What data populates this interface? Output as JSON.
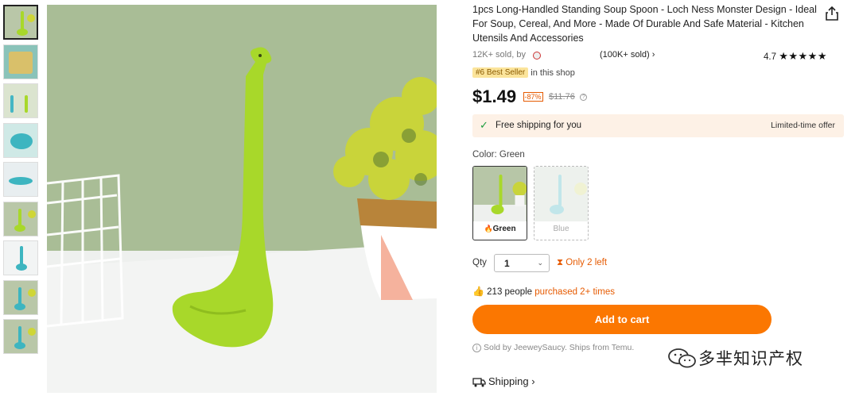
{
  "product": {
    "title": "1pcs Long-Handled Standing Soup Spoon - Loch Ness Monster Design - Ideal For Soup, Cereal, And More - Made Of Durable And Safe Material - Kitchen Utensils And Accessories",
    "sold_prefix": "12K+ sold, by",
    "store_sold": "(100K+ sold)",
    "store_chevron": "›",
    "rating": "4.7",
    "rating_stars": 4.7,
    "stars_text": "★★★★★",
    "best_seller_badge": "#6 Best Seller",
    "best_seller_suffix": "in this shop",
    "price": "$1.49",
    "discount": "-87%",
    "old_price": "$11.76",
    "price_info_icon": "?"
  },
  "shipping_banner": {
    "check_icon": "✓",
    "text": "Free shipping for you",
    "offer": "Limited-time offer"
  },
  "color": {
    "label": "Color: Green",
    "options": [
      {
        "label": "Green",
        "selected": true,
        "icon": "🔥"
      },
      {
        "label": "Blue",
        "selected": false
      }
    ]
  },
  "quantity": {
    "label": "Qty",
    "value": "1",
    "chevron": "⌄",
    "stock_icon": "⧗",
    "stock_text": "Only 2 left"
  },
  "purchased": {
    "icon": "👍",
    "count_text": "213 people",
    "suffix": "purchased 2+ times"
  },
  "cart_button": {
    "label": "Add to cart"
  },
  "sold_by": {
    "icon": "i",
    "text": "Sold by JeeweySaucy. Ships from Temu."
  },
  "shipping_link": {
    "label": "Shipping",
    "chevron": "›"
  },
  "watermark": {
    "text": "多芈知识产权"
  },
  "colors": {
    "accent_orange": "#fb7701",
    "banner_bg": "#fdf1e6",
    "spoon_green": "#a8d82a",
    "check_green": "#1a9b3c",
    "badge_yellow": "#fbe49b"
  },
  "thumbnails": [
    {
      "name": "thumb-green-spoon",
      "active": true
    },
    {
      "name": "thumb-package"
    },
    {
      "name": "thumb-spoons"
    },
    {
      "name": "thumb-blue-spoon-closeup"
    },
    {
      "name": "thumb-blue-spoon-side"
    },
    {
      "name": "thumb-green-spoon-plant"
    },
    {
      "name": "thumb-blue-spoon-white"
    },
    {
      "name": "thumb-blue-spoon-plant"
    },
    {
      "name": "thumb-blue-spoon-plant-2"
    }
  ]
}
